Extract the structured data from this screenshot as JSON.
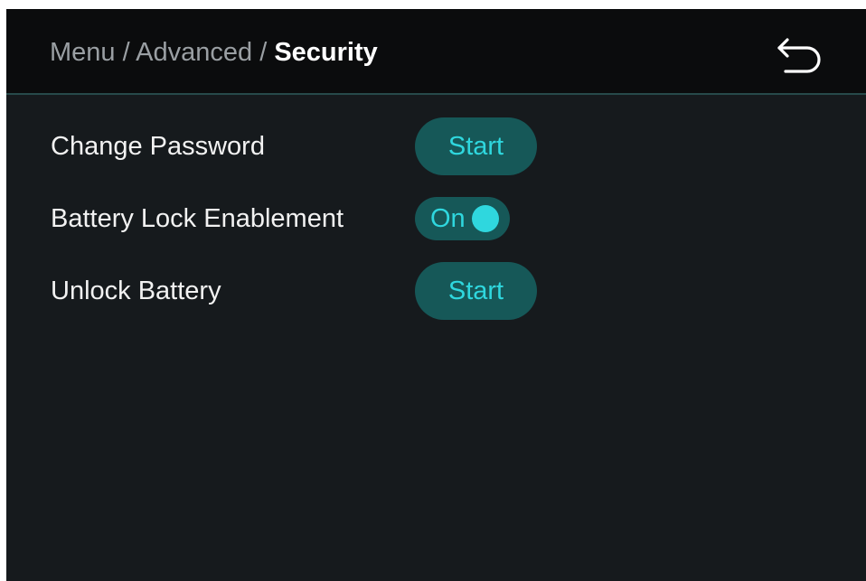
{
  "header": {
    "breadcrumb": [
      {
        "label": "Menu"
      },
      {
        "label": "Advanced"
      },
      {
        "label": "Security"
      }
    ],
    "separator": "/",
    "back_icon": "back-arrow-icon"
  },
  "settings": [
    {
      "label": "Change Password",
      "control": "button",
      "button_label": "Start"
    },
    {
      "label": "Battery Lock Enablement",
      "control": "toggle",
      "toggle_label": "On",
      "toggle_state": true
    },
    {
      "label": "Unlock Battery",
      "control": "button",
      "button_label": "Start"
    }
  ],
  "colors": {
    "background": "#161a1d",
    "header_background": "#0b0c0d",
    "accent": "#2fd7de",
    "control_background": "#165858",
    "text": "#f2f2f2",
    "breadcrumb_muted": "#9a9fa3"
  }
}
